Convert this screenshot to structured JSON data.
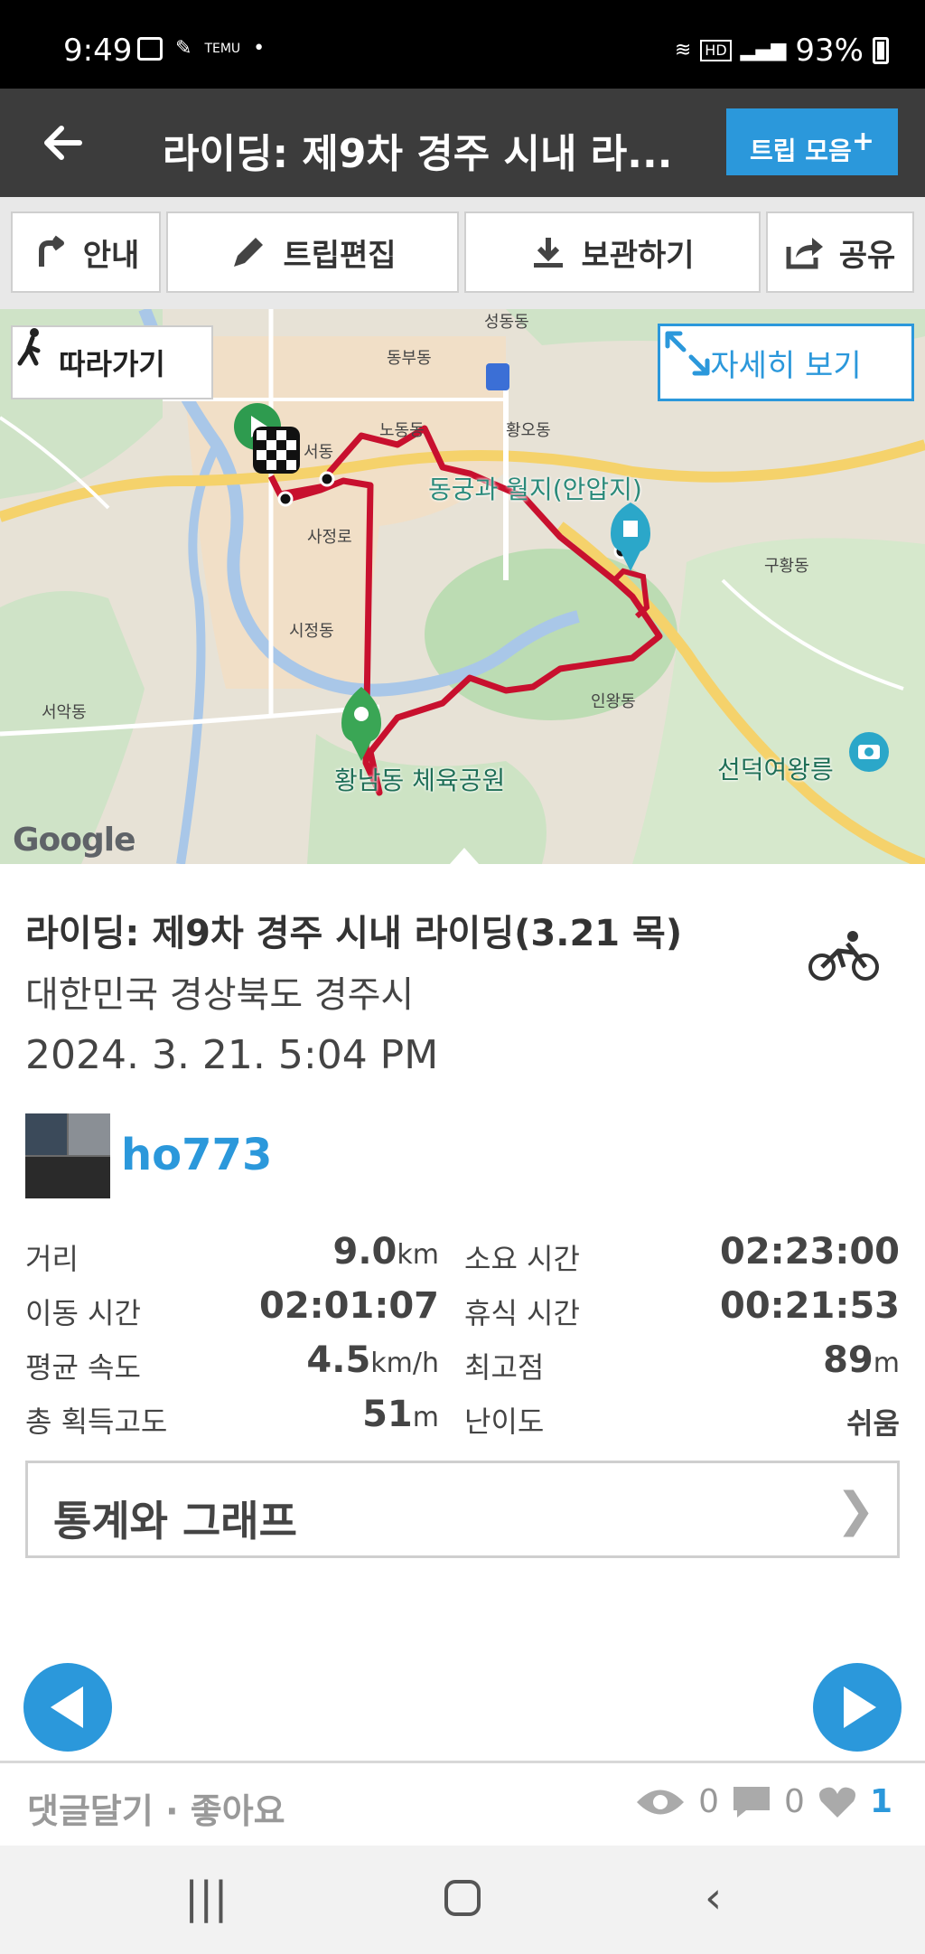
{
  "status_bar": {
    "time": "9:49",
    "battery": "93%",
    "icons": [
      "image-icon",
      "app-icon",
      "temu-icon",
      "dot-icon",
      "wifi-icon",
      "hd-icon",
      "signal-icon",
      "battery-icon"
    ]
  },
  "app_bar": {
    "title": "라이딩: 제9차 경주 시내 라...",
    "trip_button": "트립 모음"
  },
  "toolbar": {
    "guide": "안내",
    "edit": "트립편집",
    "save": "보관하기",
    "share": "공유"
  },
  "map": {
    "follow_button": "따라가기",
    "detail_button": "자세히 보기",
    "labels": {
      "anapji": "동궁과 월지(안압지)",
      "park": "황남동 체육공원",
      "tomb": "선덕여왕릉",
      "seongdong": "성동동",
      "dongbu": "동부동",
      "hwango": "황오동",
      "nodong": "노동동",
      "seodong": "서동",
      "sajeong": "사정로",
      "sijeong": "시정동",
      "seoak": "서악동",
      "inwang": "인왕동",
      "guhwang": "구황동",
      "google": "Google"
    }
  },
  "trip": {
    "title": "라이딩: 제9차 경주 시내 라이딩(3.21 목)",
    "location": "대한민국 경상북도 경주시",
    "datetime": "2024. 3. 21. 5:04 PM",
    "user": "ho773"
  },
  "stats": [
    {
      "label1": "거리",
      "value1": "9.0",
      "unit1": "km",
      "label2": "소요 시간",
      "value2": "02:23:00",
      "unit2": ""
    },
    {
      "label1": "이동 시간",
      "value1": "02:01:07",
      "unit1": "",
      "label2": "휴식 시간",
      "value2": "00:21:53",
      "unit2": ""
    },
    {
      "label1": "평균 속도",
      "value1": "4.5",
      "unit1": "km/h",
      "label2": "최고점",
      "value2": "89",
      "unit2": "m"
    },
    {
      "label1": "총 획득고도",
      "value1": "51",
      "unit1": "m",
      "label2": "난이도",
      "value2": "쉬움",
      "unit2": ""
    }
  ],
  "graph_button": "통계와 그래프",
  "footer": {
    "comment_like": "댓글달기 · 좋아요",
    "views": "0",
    "comments": "0",
    "likes": "1"
  },
  "colors": {
    "accent": "#2b98db",
    "route": "#c8102e",
    "appbar": "#3c3c3c"
  }
}
